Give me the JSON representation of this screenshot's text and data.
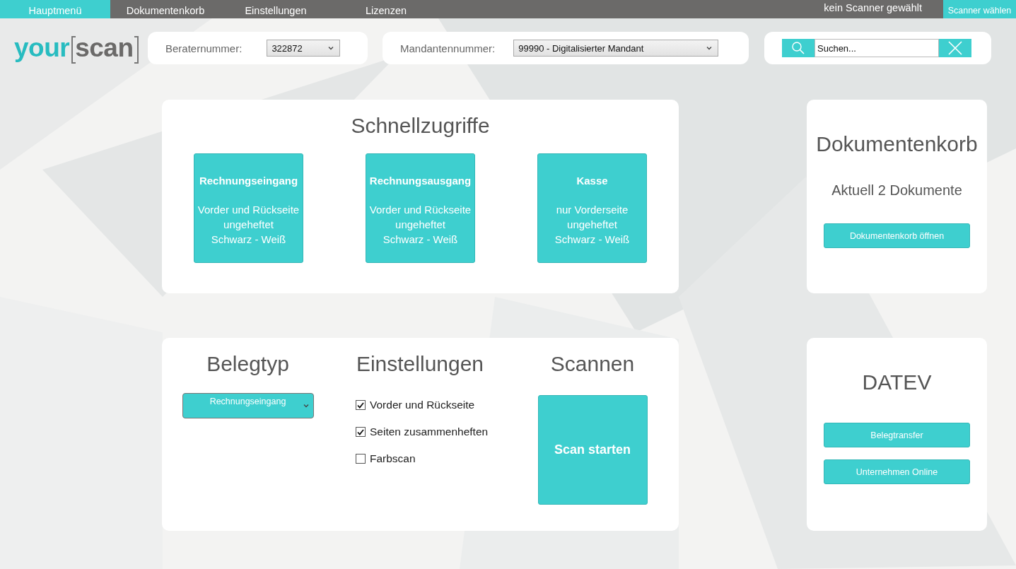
{
  "menu": {
    "items": [
      {
        "label": "Hauptmenü",
        "selected": true
      },
      {
        "label": "Dokumentenkorb",
        "selected": false
      },
      {
        "label": "Einstellungen",
        "selected": false
      },
      {
        "label": "Lizenzen",
        "selected": false
      }
    ],
    "scanner_status": "kein Scanner gewählt",
    "scanner_button": "Scanner wählen"
  },
  "logo": {
    "part_1": "your",
    "part_2": "scan"
  },
  "berater": {
    "label": "Beraternummer:",
    "value": "322872"
  },
  "mandant": {
    "label": "Mandantennummer:",
    "value": "99990 - Digitalisierter Mandant"
  },
  "search": {
    "value": "Suchen..."
  },
  "quick_access": {
    "title": "Schnellzugriffe",
    "tiles": [
      {
        "title": "Rechnungseingang",
        "lines": [
          "Vorder und Rückseite",
          "ungeheftet",
          "Schwarz - Weiß"
        ]
      },
      {
        "title": "Rechnungsausgang",
        "lines": [
          "Vorder und Rückseite",
          "ungeheftet",
          "Schwarz - Weiß"
        ]
      },
      {
        "title": "Kasse",
        "lines": [
          "nur Vorderseite",
          "ungeheftet",
          "Schwarz - Weiß"
        ]
      }
    ]
  },
  "document_basket": {
    "title": "Dokumentenkorb",
    "info": "Aktuell 2 Dokumente",
    "button": "Dokumentenkorb öffnen"
  },
  "scan_panel": {
    "belegtyp": {
      "title": "Belegtyp",
      "value": "Rechnungseingang"
    },
    "settings": {
      "title": "Einstellungen",
      "options": [
        {
          "label": "Vorder und Rückseite",
          "checked": true
        },
        {
          "label": "Seiten zusammenheften",
          "checked": true
        },
        {
          "label": "Farbscan",
          "checked": false
        }
      ]
    },
    "scanning": {
      "title": "Scannen",
      "button": "Scan starten"
    }
  },
  "datev": {
    "title": "DATEV",
    "buttons": [
      "Belegtransfer",
      "Unternehmen Online"
    ]
  }
}
